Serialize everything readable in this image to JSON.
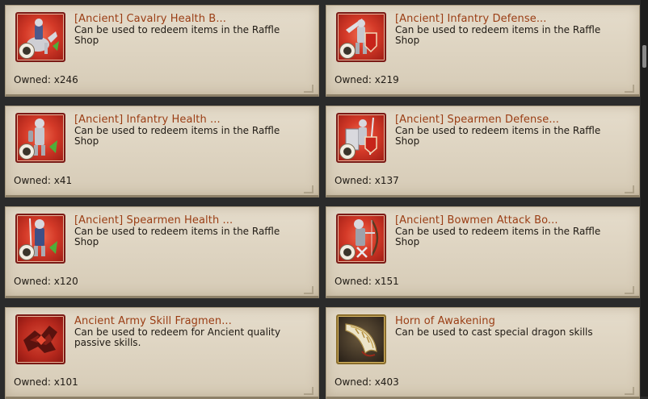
{
  "items": [
    {
      "title": "[Ancient] Cavalry Health B...",
      "desc": "Can be used to redeem items in the Raffle Shop",
      "owned": "Owned: x246",
      "icon": "cavalry-icon"
    },
    {
      "title": "[Ancient] Infantry Defense...",
      "desc": "Can be used to redeem items in the Raffle Shop",
      "owned": "Owned: x219",
      "icon": "infantry-defense-icon"
    },
    {
      "title": "[Ancient] Infantry Health ...",
      "desc": "Can be used to redeem items in the Raffle Shop",
      "owned": "Owned: x41",
      "icon": "infantry-health-icon"
    },
    {
      "title": "[Ancient] Spearmen Defense...",
      "desc": "Can be used to redeem items in the Raffle Shop",
      "owned": "Owned: x137",
      "icon": "spearmen-defense-icon"
    },
    {
      "title": "[Ancient] Spearmen Health ...",
      "desc": "Can be used to redeem items in the Raffle Shop",
      "owned": "Owned: x120",
      "icon": "spearmen-health-icon"
    },
    {
      "title": "[Ancient] Bowmen Attack Bo...",
      "desc": "Can be used to redeem items in the Raffle Shop",
      "owned": "Owned: x151",
      "icon": "bowmen-attack-icon"
    },
    {
      "title": "Ancient Army Skill Fragmen...",
      "desc": "Can be used to redeem for Ancient quality passive skills.",
      "owned": "Owned: x101",
      "icon": "skill-fragment-icon"
    },
    {
      "title": "Horn of Awakening",
      "desc": "Can be used to cast special dragon skills",
      "owned": "Owned: x403",
      "icon": "horn-icon"
    }
  ],
  "colors": {
    "title": "#9a3d14",
    "text": "#1f1a14",
    "card": "#e0d6c4",
    "background": "#2b2b2b"
  }
}
